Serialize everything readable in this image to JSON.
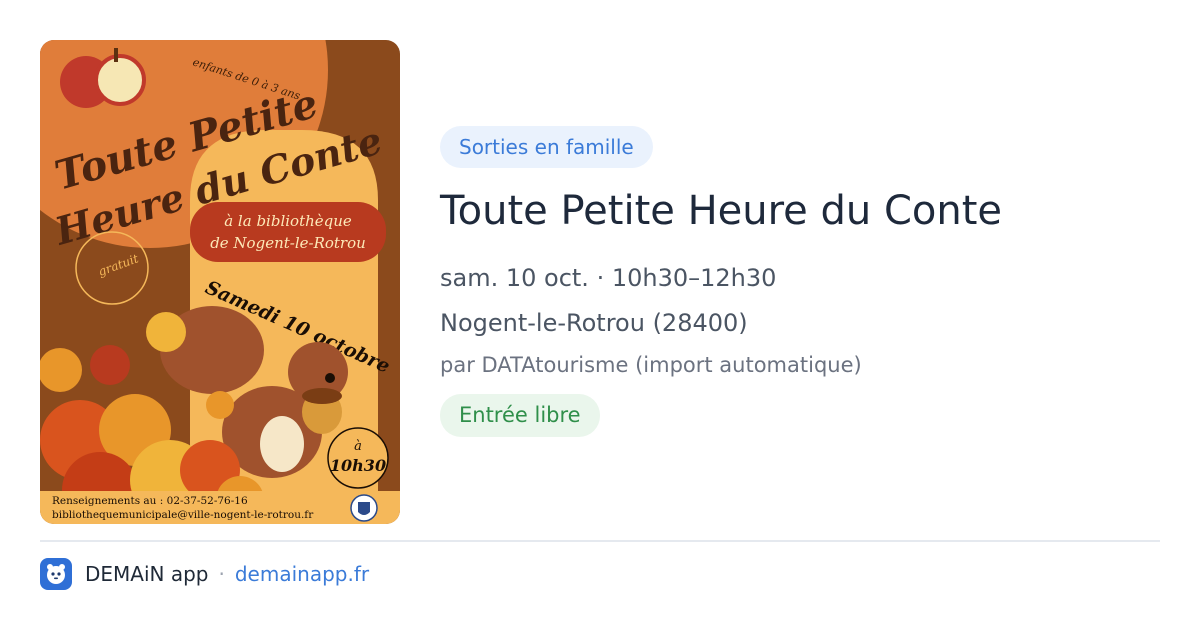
{
  "poster": {
    "age_note": "enfants de 0 à 3 ans",
    "title_line1": "Toute Petite",
    "title_line2": "Heure du Conte",
    "venue_line1": "à la bibliothèque",
    "venue_line2": "de Nogent-le-Rotrou",
    "free_badge": "gratuit",
    "date_text": "Samedi 10 octobre",
    "time_prefix": "à",
    "time_text": "10h30",
    "contact_line1": "Renseignements au : 02-37-52-76-16",
    "contact_line2": "bibliothequemunicipale@ville-nogent-le-rotrou.fr"
  },
  "event": {
    "category": "Sorties en famille",
    "title": "Toute Petite Heure du Conte",
    "datetime": "sam. 10 oct. · 10h30–12h30",
    "location": "Nogent-le-Rotrou (28400)",
    "source": "par DATAtourisme (import automatique)",
    "price": "Entrée libre"
  },
  "footer": {
    "app_name": "DEMAiN app",
    "separator": "·",
    "url": "demainapp.fr"
  },
  "colors": {
    "poster_brown": "#8b4a1c",
    "poster_orange": "#e07d3a",
    "poster_yellow": "#f5b85a",
    "banner_red": "#b83a1f",
    "category_bg": "#eaf2fd",
    "category_text": "#3b7bd8",
    "price_bg": "#eaf6ec",
    "price_text": "#2f8f4a",
    "link": "#3b7bd8"
  }
}
